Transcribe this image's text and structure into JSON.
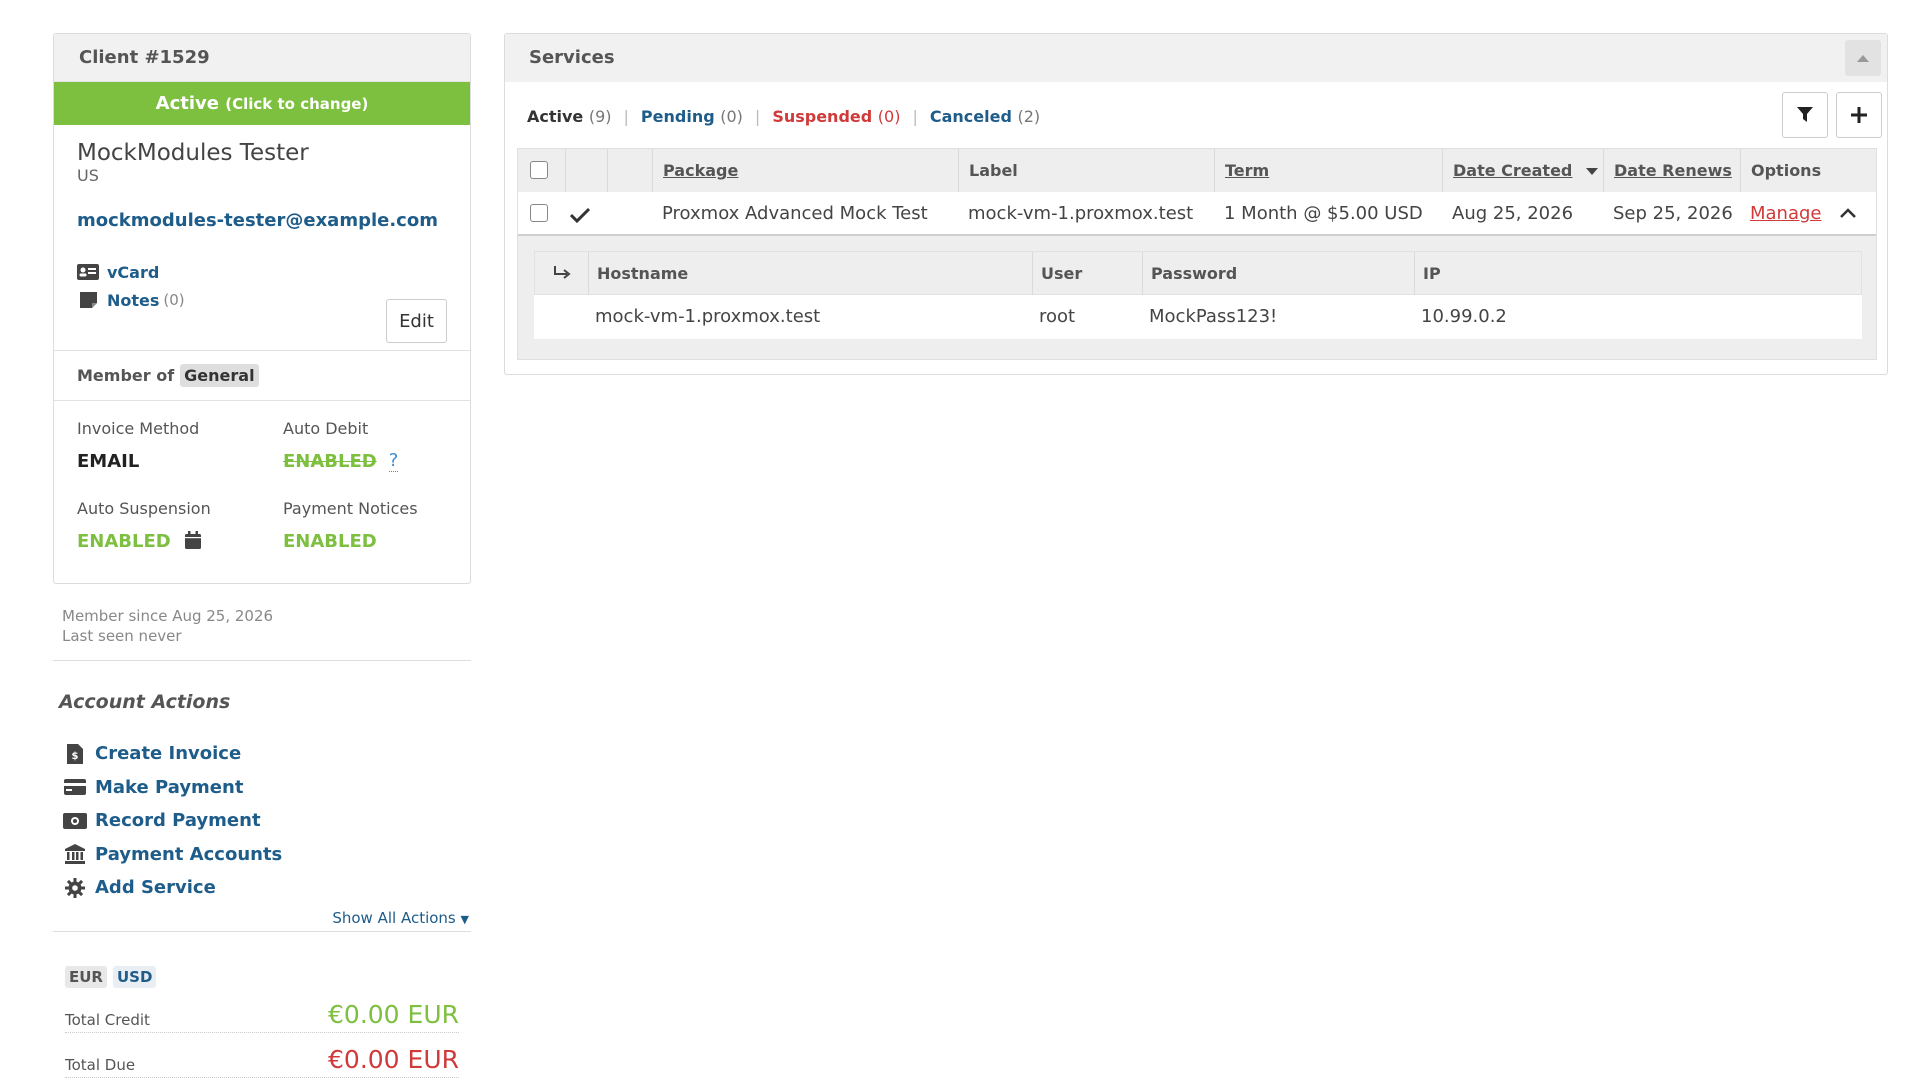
{
  "client": {
    "title": "Client #1529",
    "status": "Active",
    "status_hint": "(Click to change)",
    "name": "MockModules Tester",
    "country": "US",
    "email": "mockmodules-tester@example.com",
    "vcard_label": "vCard",
    "notes_label": "Notes",
    "notes_count": "(0)",
    "edit_label": "Edit",
    "member_of_label": "Member of",
    "group": "General",
    "invoice_method_label": "Invoice Method",
    "invoice_method_value": "EMAIL",
    "auto_debit_label": "Auto Debit",
    "auto_debit_value": "ENABLED",
    "auto_debit_help": "?",
    "auto_suspension_label": "Auto Suspension",
    "auto_suspension_value": "ENABLED",
    "payment_notices_label": "Payment Notices",
    "payment_notices_value": "ENABLED",
    "member_since": "Member since Aug 25, 2026",
    "last_seen": "Last seen never"
  },
  "account_actions": {
    "title": "Account Actions",
    "items": [
      {
        "label": "Create Invoice",
        "icon": "invoice-icon"
      },
      {
        "label": "Make Payment",
        "icon": "credit-card-icon"
      },
      {
        "label": "Record Payment",
        "icon": "money-icon"
      },
      {
        "label": "Payment Accounts",
        "icon": "bank-icon"
      },
      {
        "label": "Add Service",
        "icon": "gear-icon"
      }
    ],
    "show_all": "Show All Actions"
  },
  "currency": {
    "tabs": [
      "EUR",
      "USD"
    ],
    "total_credit_label": "Total Credit",
    "total_credit_value": "€0.00 EUR",
    "total_due_label": "Total Due",
    "total_due_value": "€0.00 EUR"
  },
  "services": {
    "title": "Services",
    "filters": [
      {
        "label": "Active",
        "count": "(9)"
      },
      {
        "label": "Pending",
        "count": "(0)"
      },
      {
        "label": "Suspended",
        "count": "(0)"
      },
      {
        "label": "Canceled",
        "count": "(2)"
      }
    ],
    "columns": {
      "package": "Package",
      "label": "Label",
      "term": "Term",
      "date_created": "Date Created",
      "date_renews": "Date Renews",
      "options": "Options"
    },
    "rows": [
      {
        "package": "Proxmox Advanced Mock Test",
        "label": "mock-vm-1.proxmox.test",
        "term": "1 Month @ $5.00 USD",
        "date_created": "Aug 25, 2026",
        "date_renews": "Sep 25, 2026",
        "manage": "Manage"
      }
    ],
    "details": {
      "columns": {
        "hostname": "Hostname",
        "user": "User",
        "password": "Password",
        "ip": "IP"
      },
      "row": {
        "hostname": "mock-vm-1.proxmox.test",
        "user": "root",
        "password": "MockPass123!",
        "ip": "10.99.0.2"
      }
    }
  },
  "colors": {
    "active_green": "#7dbf3f",
    "link_blue": "#1e5c8a",
    "danger_red": "#d03a3a"
  }
}
